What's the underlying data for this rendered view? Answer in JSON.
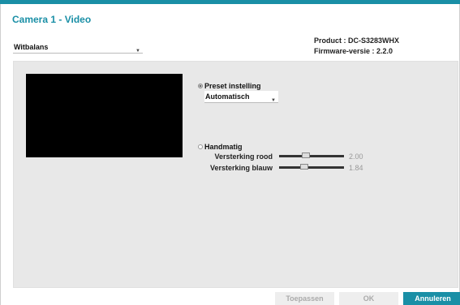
{
  "window": {
    "title": "Camera 1 - Video",
    "accent_color": "#1a8fa6"
  },
  "category_select": {
    "value": "Witbalans",
    "icon": "chevron-down-icon"
  },
  "device_info": {
    "product": "Product : DC-S3283WHX",
    "firmware": "Firmware-versie : 2.2.0"
  },
  "white_balance": {
    "preset": {
      "label": "Preset instelling",
      "selected": true,
      "select_value": "Automatisch"
    },
    "manual": {
      "label": "Handmatig",
      "selected": false,
      "red_gain": {
        "label": "Versterking rood",
        "value": "2.00",
        "level": 0.4
      },
      "blue_gain": {
        "label": "Versterking blauw",
        "value": "1.84",
        "level": 0.37
      }
    }
  },
  "buttons": {
    "apply": "Toepassen",
    "ok": "OK",
    "cancel": "Annuleren"
  }
}
